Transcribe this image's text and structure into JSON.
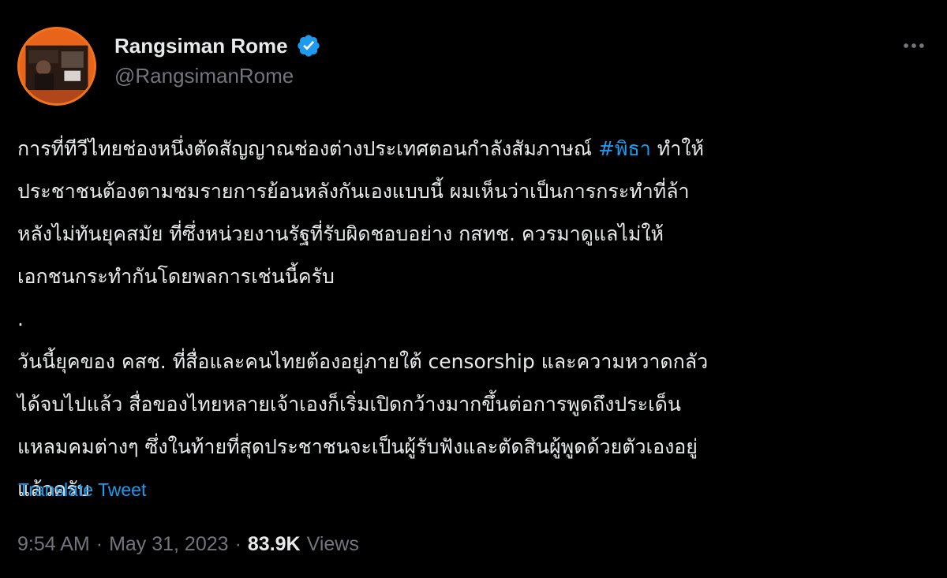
{
  "author": {
    "display_name": "Rangsiman Rome",
    "handle": "@RangsimanRome",
    "verified": true,
    "avatar_icon": "profile-avatar"
  },
  "header": {
    "more_icon": "more-horizontal-icon"
  },
  "tweet": {
    "lines": [
      {
        "pre": "การที่ทีวีไทยช่องหนึ่งตัดสัญญาณช่องต่างประเทศตอนกำลังสัมภาษณ์ ",
        "hashtag": "#พิธา",
        "post": " ทำให้"
      },
      {
        "text": "ประชาชนต้องตามชมรายการย้อนหลังกันเองแบบนี้ ผมเห็นว่าเป็นการกระทำที่ล้า"
      },
      {
        "text": "หลังไม่ทันยุคสมัย ที่ซึ่งหน่วยงานรัฐที่รับผิดชอบอย่าง กสทช. ควรมาดูแลไม่ให้"
      },
      {
        "text": "เอกชนกระทำกันโดยพลการเช่นนี้ครับ"
      },
      {
        "text": "."
      },
      {
        "text": "วันนี้ยุคของ คสช. ที่สื่อและคนไทยต้องอยู่ภายใต้ censorship และความหวาดกลัว"
      },
      {
        "text": "ได้จบไปแล้ว สื่อของไทยหลายเจ้าเองก็เริ่มเปิดกว้างมากขึ้นต่อการพูดถึงประเด็น"
      },
      {
        "text": "แหลมคมต่างๆ ซึ่งในท้ายที่สุดประชาชนจะเป็นผู้รับฟังและตัดสินผู้พูดด้วยตัวเองอยู่"
      },
      {
        "text": "แล้วครับ"
      }
    ],
    "translate_label": "Translate Tweet"
  },
  "meta": {
    "time": "9:54 AM",
    "separator": "·",
    "date": "May 31, 2023",
    "views_count": "83.9K",
    "views_label": "Views"
  },
  "colors": {
    "background": "#000000",
    "text": "#e7e9ea",
    "muted": "#71767b",
    "link": "#1d9bf0",
    "verified": "#1d9bf0"
  }
}
